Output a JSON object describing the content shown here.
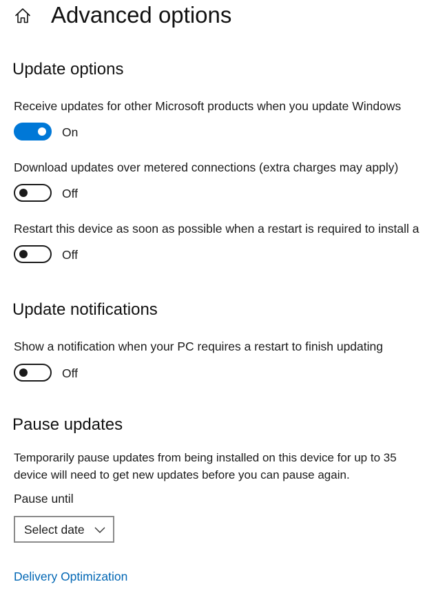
{
  "header": {
    "home_icon": "home-icon",
    "title": "Advanced options"
  },
  "update_options": {
    "title": "Update options",
    "settings": [
      {
        "label": "Receive updates for other Microsoft products when you update Windows",
        "state": "On",
        "enabled": true
      },
      {
        "label": "Download updates over metered connections (extra charges may apply)",
        "state": "Off",
        "enabled": false
      },
      {
        "label": "Restart this device as soon as possible when a restart is required to install a",
        "state": "Off",
        "enabled": false
      }
    ]
  },
  "update_notifications": {
    "title": "Update notifications",
    "settings": [
      {
        "label": "Show a notification when your PC requires a restart to finish updating",
        "state": "Off",
        "enabled": false
      }
    ]
  },
  "pause_updates": {
    "title": "Pause updates",
    "description_lines": [
      "Temporarily pause updates from being installed on this device for up to 35",
      "device will need to get new updates before you can pause again."
    ],
    "pause_until_label": "Pause until",
    "select_value": "Select date",
    "select_icon": "chevron-down-icon"
  },
  "links": {
    "delivery_optimization": "Delivery Optimization"
  },
  "colors": {
    "accent": "#0078d7",
    "link": "#0066b4",
    "text": "#1a1a1a",
    "select_border": "#8a8a8a"
  }
}
